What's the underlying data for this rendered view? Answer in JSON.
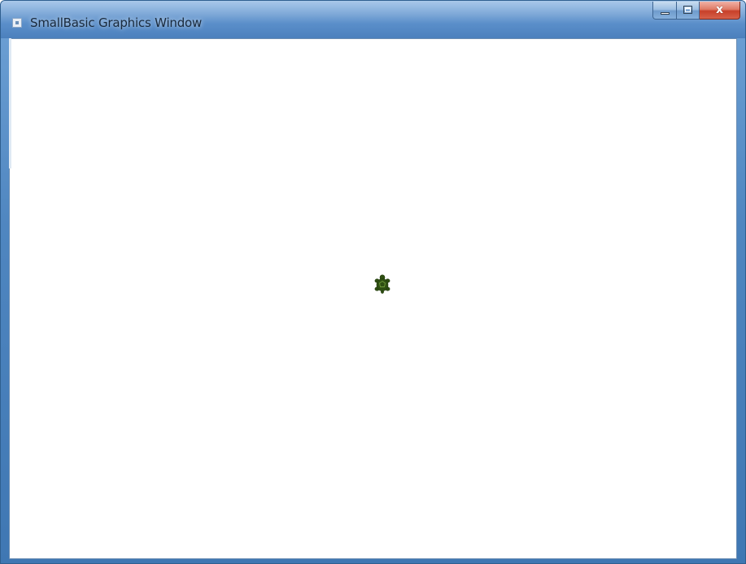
{
  "window": {
    "title": "SmallBasic Graphics Window",
    "minimize_icon": "minimize-icon",
    "maximize_icon": "maximize-icon",
    "close_icon": "close-icon",
    "close_glyph": "x"
  },
  "canvas": {
    "background": "#ffffff",
    "turtle": {
      "icon": "turtle-icon",
      "color": "#2e4f12"
    }
  },
  "colors": {
    "titlebar_accent": "#4b80bd",
    "close_button": "#c7402a"
  }
}
